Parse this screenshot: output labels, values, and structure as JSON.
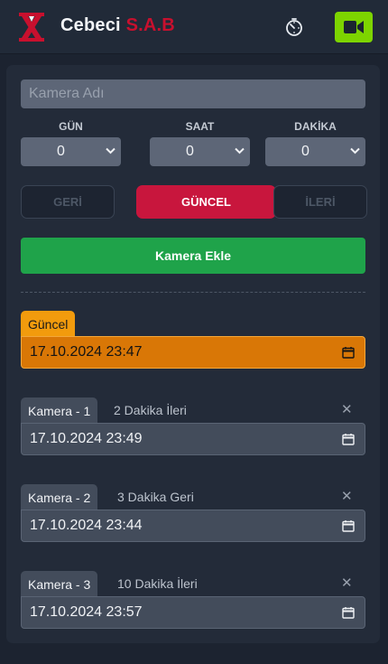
{
  "header": {
    "brand_main": "Cebeci",
    "brand_accent": "S.A.B",
    "logo_icon": "hourglass-x-icon",
    "timer_icon": "timer-icon",
    "camera_icon": "video-camera-icon",
    "colors": {
      "accent": "#c8102e",
      "camera_button": "#7dd400"
    }
  },
  "form": {
    "name_placeholder": "Kamera Adı",
    "name_value": "",
    "labels": {
      "day": "GÜN",
      "hour": "SAAT",
      "minute": "DAKİKA"
    },
    "selects": {
      "day": "0",
      "hour": "0",
      "minute": "0"
    },
    "nav": {
      "back": "GERİ",
      "current": "GÜNCEL",
      "forward": "İLERİ"
    },
    "add_button": "Kamera Ekle"
  },
  "current": {
    "label": "Güncel",
    "datetime": "17.10.2024 23:47"
  },
  "cameras": [
    {
      "name": "Kamera - 1",
      "offset": "2 Dakika İleri",
      "datetime": "17.10.2024 23:49"
    },
    {
      "name": "Kamera - 2",
      "offset": "3 Dakika Geri",
      "datetime": "17.10.2024 23:44"
    },
    {
      "name": "Kamera - 3",
      "offset": "10 Dakika İleri",
      "datetime": "17.10.2024 23:57"
    }
  ]
}
